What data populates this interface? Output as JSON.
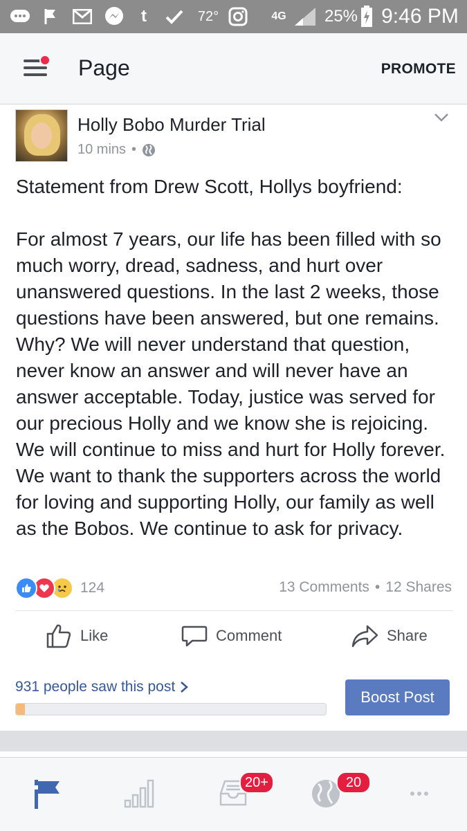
{
  "status_bar": {
    "temperature": "72°",
    "network": "4G",
    "battery": "25%",
    "time": "9:46 PM"
  },
  "header": {
    "title": "Page",
    "promote_label": "PROMOTE"
  },
  "post": {
    "page_name": "Holly Bobo Murder Trial",
    "time_ago": "10 mins",
    "body": "Statement from Drew Scott, Hollys boyfriend:\n\nFor almost 7 years, our life has been filled with so much worry, dread, sadness, and hurt over unanswered questions. In the last 2 weeks, those questions have been answered, but one remains. Why? We will never understand that question, never know an answer and will never have an answer acceptable. Today, justice was served for our precious Holly and we know she is rejoicing. We will continue to miss and hurt for Holly forever. We want to thank the supporters across the world for loving and supporting Holly, our family as well as the Bobos. We continue to ask for privacy.",
    "reaction_count": "124",
    "comments": "13 Comments",
    "shares": "12 Shares",
    "actions": {
      "like": "Like",
      "comment": "Comment",
      "share": "Share"
    },
    "reach_text": "931 people saw this post",
    "reach_fraction": 0.03,
    "boost_label": "Boost Post"
  },
  "bottom_nav": {
    "notifications_badge": "20+",
    "globe_badge": "20"
  },
  "colors": {
    "accent": "#365899",
    "boost": "#5b7bc0",
    "badge": "#e41e3f"
  }
}
